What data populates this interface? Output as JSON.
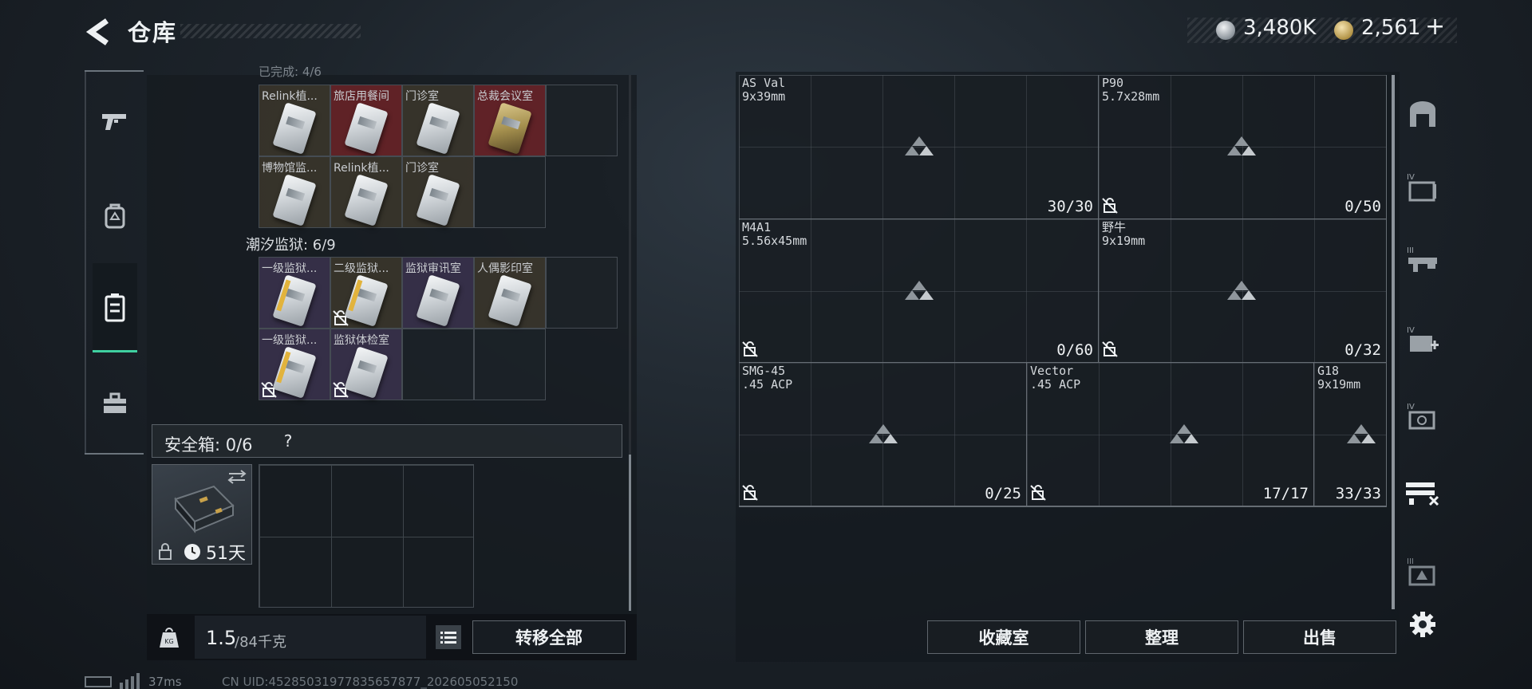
{
  "header": {
    "title": "仓库",
    "currency": {
      "silver": "3,480K",
      "gold": "2,561",
      "add": "+"
    }
  },
  "left_nav": {
    "items": [
      {
        "icon": "pistol-icon",
        "active": false
      },
      {
        "icon": "backpack-icon",
        "active": false
      },
      {
        "icon": "container-icon",
        "active": true
      },
      {
        "icon": "toolbox-icon",
        "active": false
      }
    ]
  },
  "keycards": {
    "section_cut_label": "已完成: 4/6",
    "section1": {
      "row1": [
        {
          "label": "Relink植...",
          "tint": "gold"
        },
        {
          "label": "旅店用餐间",
          "tint": "red"
        },
        {
          "label": "门诊室",
          "tint": "gold"
        },
        {
          "label": "总裁会议室",
          "tint": "red"
        }
      ],
      "row2": [
        {
          "label": "博物馆监...",
          "tint": "gold"
        },
        {
          "label": "Relink植...",
          "tint": "gold"
        },
        {
          "label": "门诊室",
          "tint": "gold"
        }
      ]
    },
    "section2": {
      "title": "潮汐监狱: 6/9",
      "row1": [
        {
          "label": "一级监狱...",
          "tint": "purple"
        },
        {
          "label": "二级监狱...",
          "tint": "gold"
        },
        {
          "label": "监狱审讯室",
          "tint": "purple"
        },
        {
          "label": "人偶影印室",
          "tint": "gold"
        }
      ],
      "row2": [
        {
          "label": "一级监狱...",
          "tint": "purple"
        },
        {
          "label": "监狱体检室",
          "tint": "purple"
        }
      ]
    }
  },
  "safebox": {
    "label": "安全箱: 0/6",
    "help": "?",
    "days": "51天"
  },
  "weight": {
    "current": "1.5",
    "max": "/84千克"
  },
  "buttons": {
    "transfer_all": "转移全部",
    "collection": "收藏室",
    "tidy": "整理",
    "sell": "出售"
  },
  "stash": {
    "guns": [
      {
        "name": "AS Val",
        "ammo": "9x39mm",
        "count": "30/30",
        "locked": false
      },
      {
        "name": "P90",
        "ammo": "5.7x28mm",
        "count": "0/50",
        "locked": true
      },
      {
        "name": "M4A1",
        "ammo": "5.56x45mm",
        "count": "0/60",
        "locked": true
      },
      {
        "name": "野牛",
        "ammo": "9x19mm",
        "count": "0/32",
        "locked": true
      },
      {
        "name": "SMG-45",
        "ammo": ".45 ACP",
        "count": "0/25",
        "locked": true
      },
      {
        "name": "Vector",
        "ammo": ".45 ACP",
        "count": "17/17",
        "locked": true
      },
      {
        "name": "G18",
        "ammo": "9x19mm",
        "count": "33/33",
        "locked": false
      }
    ]
  },
  "status_bar": {
    "ping": "37ms",
    "uid": "CN UID:452850319778356578​77_202605052150"
  }
}
